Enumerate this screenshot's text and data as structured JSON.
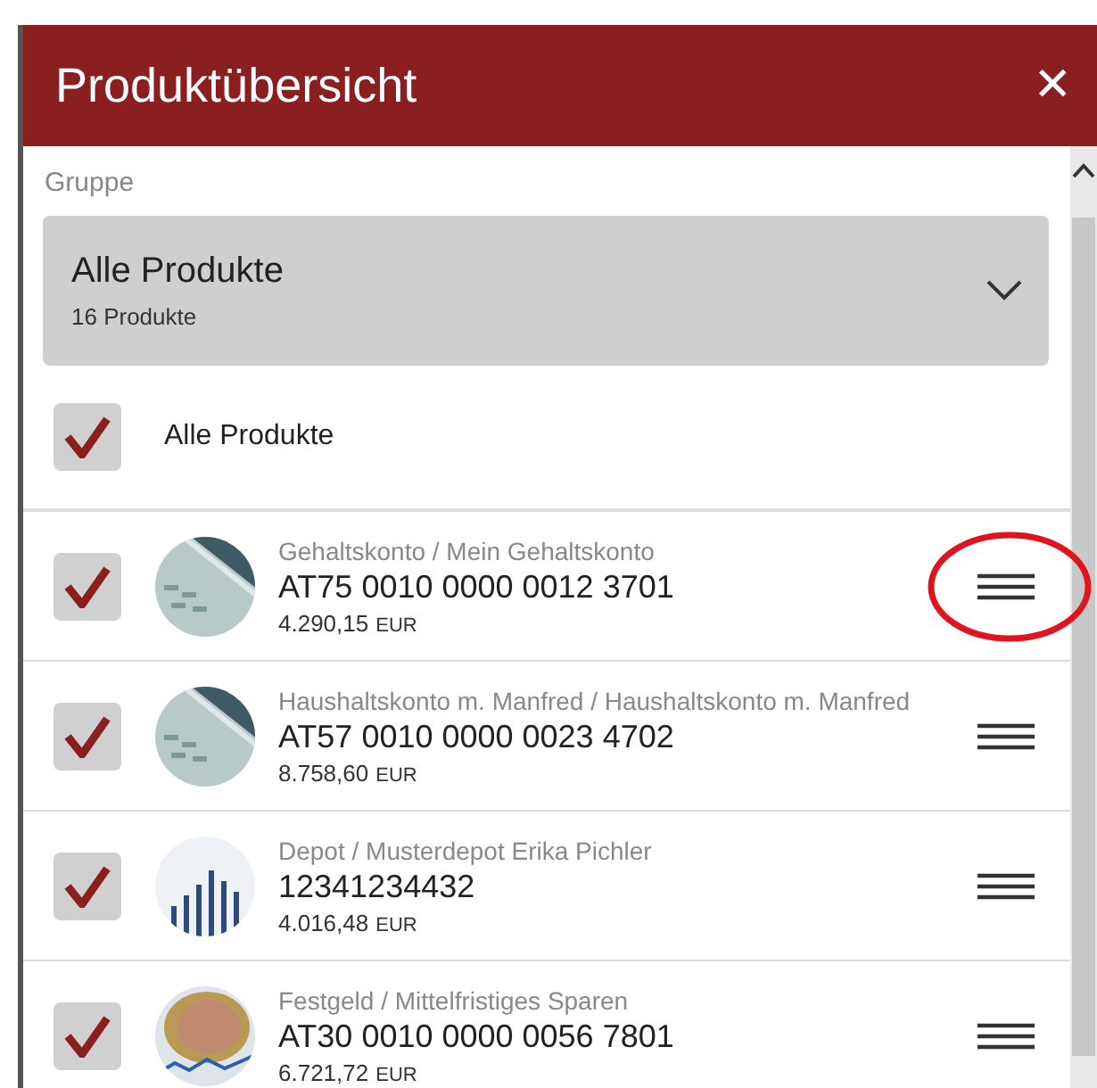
{
  "dialog": {
    "title": "Produktübersicht",
    "close_label": "✕"
  },
  "group": {
    "label": "Gruppe",
    "value": "Alle Produkte",
    "count": "16 Produkte"
  },
  "select_all": {
    "label": "Alle Produkte",
    "checked": true
  },
  "products": [
    {
      "category": "Gehaltskonto / Mein Gehaltskonto",
      "number": "AT75 0010 0000 0012 3701",
      "amount": "4.290,15",
      "currency": "EUR",
      "checked": true,
      "kind": "card",
      "highlighted": true
    },
    {
      "category": "Haushaltskonto m. Manfred / Haushaltskonto m. Manfred",
      "number": "AT57 0010 0000 0023 4702",
      "amount": "8.758,60",
      "currency": "EUR",
      "checked": true,
      "kind": "card",
      "highlighted": false
    },
    {
      "category": "Depot / Musterdepot Erika Pichler",
      "number": "12341234432",
      "amount": "4.016,48",
      "currency": "EUR",
      "checked": true,
      "kind": "chart",
      "highlighted": false
    },
    {
      "category": "Festgeld / Mittelfristiges Sparen",
      "number": "AT30 0010 0000 0056 7801",
      "amount": "6.721,72",
      "currency": "EUR",
      "checked": true,
      "kind": "coin",
      "highlighted": false
    }
  ]
}
